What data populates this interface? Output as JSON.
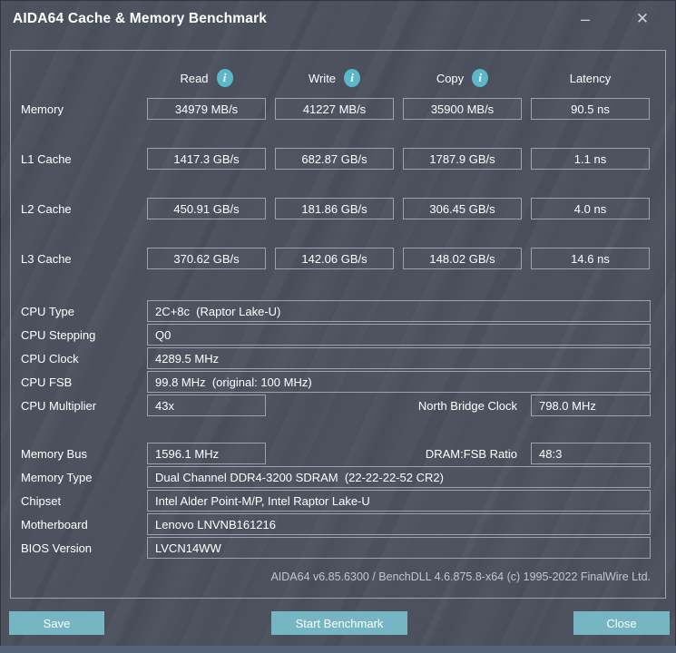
{
  "window": {
    "title": "AIDA64 Cache & Memory Benchmark",
    "minimize_glyph": "–",
    "close_glyph": "✕"
  },
  "columns": {
    "read": "Read",
    "write": "Write",
    "copy": "Copy",
    "latency": "Latency"
  },
  "info_icon_glyph": "i",
  "benchmark_rows": [
    {
      "label": "Memory",
      "read": "34979 MB/s",
      "write": "41227 MB/s",
      "copy": "35900 MB/s",
      "latency": "90.5 ns"
    },
    {
      "label": "L1 Cache",
      "read": "1417.3 GB/s",
      "write": "682.87 GB/s",
      "copy": "1787.9 GB/s",
      "latency": "1.1 ns"
    },
    {
      "label": "L2 Cache",
      "read": "450.91 GB/s",
      "write": "181.86 GB/s",
      "copy": "306.45 GB/s",
      "latency": "4.0 ns"
    },
    {
      "label": "L3 Cache",
      "read": "370.62 GB/s",
      "write": "142.06 GB/s",
      "copy": "148.02 GB/s",
      "latency": "14.6 ns"
    }
  ],
  "cpu_info": {
    "cpu_type": {
      "label": "CPU Type",
      "value": "2C+8c  (Raptor Lake-U)"
    },
    "cpu_stepping": {
      "label": "CPU Stepping",
      "value": "Q0"
    },
    "cpu_clock": {
      "label": "CPU Clock",
      "value": "4289.5 MHz"
    },
    "cpu_fsb": {
      "label": "CPU FSB",
      "value": "99.8 MHz  (original: 100 MHz)"
    },
    "cpu_multiplier": {
      "label": "CPU Multiplier",
      "value": "43x"
    },
    "north_bridge": {
      "label": "North Bridge Clock",
      "value": "798.0 MHz"
    }
  },
  "memory_info": {
    "memory_bus": {
      "label": "Memory Bus",
      "value": "1596.1 MHz"
    },
    "dram_fsb": {
      "label": "DRAM:FSB Ratio",
      "value": "48:3"
    },
    "memory_type": {
      "label": "Memory Type",
      "value": "Dual Channel DDR4-3200 SDRAM  (22-22-22-52 CR2)"
    },
    "chipset": {
      "label": "Chipset",
      "value": "Intel Alder Point-M/P, Intel Raptor Lake-U"
    },
    "motherboard": {
      "label": "Motherboard",
      "value": "Lenovo LNVNB161216"
    },
    "bios": {
      "label": "BIOS Version",
      "value": "LVCN14WW"
    }
  },
  "footer": {
    "version_text": "AIDA64 v6.85.6300 / BenchDLL 4.6.875.8-x64  (c) 1995-2022 FinalWire Ltd."
  },
  "buttons": {
    "save": "Save",
    "start": "Start Benchmark",
    "close": "Close"
  },
  "colors": {
    "background": "#4b515d",
    "accent_teal": "#76b5c3",
    "info_icon": "#5cb7c9",
    "field_border": "#9da3ac",
    "bottom_strip": "#56617a"
  }
}
